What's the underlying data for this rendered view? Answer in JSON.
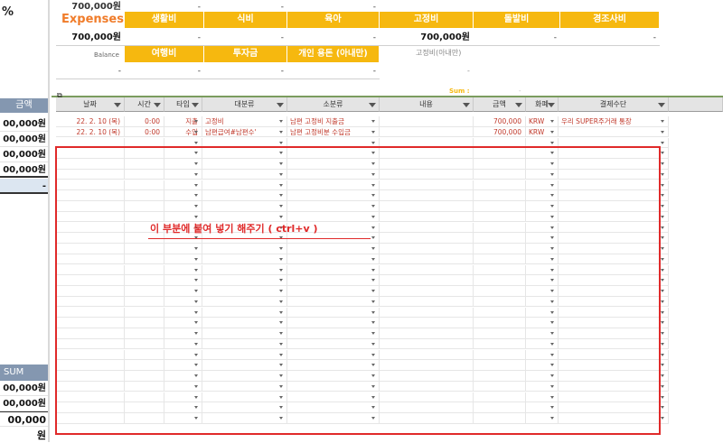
{
  "left_col": {
    "pct": "%",
    "amount_header": "금액",
    "sum_label": "SUM",
    "top_rows": [
      "00,000원",
      "00,000원",
      "00,000원",
      "00,000원",
      "-"
    ],
    "bottom_rows": [
      "00,000원",
      "00,000원",
      "00,000원"
    ]
  },
  "top_section": {
    "top_value": "700,000원",
    "expenses_label": "Expenses",
    "expenses_value": "700,000원",
    "balance_label": "Balance",
    "balance_dash": "-",
    "categories_row1": [
      "생활비",
      "식비",
      "육아",
      "고정비",
      "돌발비",
      "경조사비"
    ],
    "values_row1": [
      "-",
      "-",
      "-",
      "700,000원",
      "-",
      "-"
    ],
    "categories_row2": [
      "여행비",
      "투자금",
      "개인 용돈 (아내만)"
    ],
    "values_row2": [
      "-",
      "-",
      "-"
    ],
    "side_label": "고정비(아내만)",
    "side_value": "-",
    "sum_label": "Sum :",
    "sum_value": "-"
  },
  "table": {
    "headers": [
      "날짜",
      "시간",
      "타입",
      "대분류",
      "소분류",
      "내용",
      "금액",
      "화폐",
      "결제수단"
    ],
    "rows": [
      {
        "date": "22. 2. 10 (목)",
        "time": "0:00",
        "type": "지출",
        "cat1": "고정비",
        "cat2": "남편 고정비 지출금",
        "memo": "",
        "amount": "700,000",
        "currency": "KRW",
        "payment": "우리 SUPER주거래 통장"
      },
      {
        "date": "22. 2. 10 (목)",
        "time": "0:00",
        "type": "수입",
        "cat1": "남편급여#남편수'",
        "cat2": "남편 고정비분 수입금",
        "memo": "",
        "amount": "700,000",
        "currency": "KRW",
        "payment": ""
      }
    ],
    "empty_rows": 27
  },
  "annotation": {
    "text": "이 부분에 붙여 넣기 해주기 ( ctrl+v )",
    "color": "#e02a2a"
  },
  "colors": {
    "accent": "#f6b80f",
    "expenses": "#f07c2a",
    "annotation": "#e02a2a",
    "type_text": "#c0392b"
  }
}
